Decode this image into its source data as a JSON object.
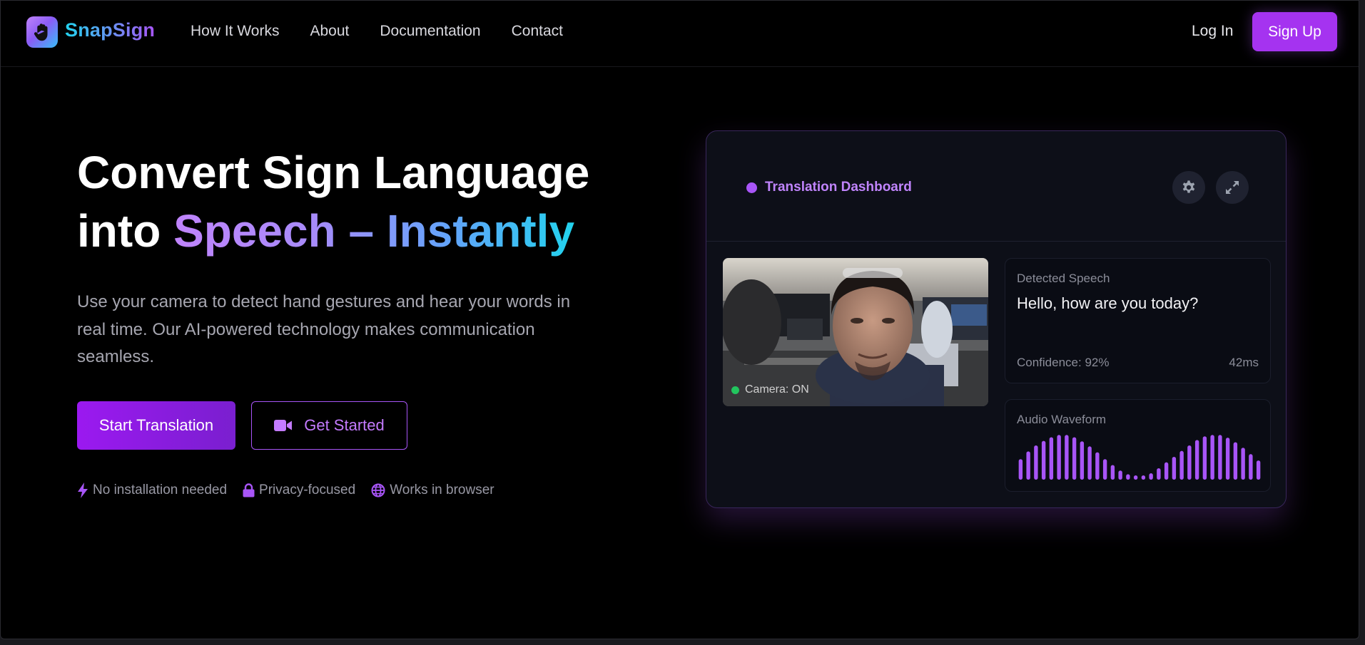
{
  "brand": {
    "name": "SnapSign",
    "logo_icon": "hand-icon"
  },
  "nav": {
    "links": [
      "How It Works",
      "About",
      "Documentation",
      "Contact"
    ],
    "login": "Log In",
    "signup": "Sign Up"
  },
  "hero": {
    "title_line1": "Convert Sign Language",
    "title_line2_plain": "into ",
    "title_line2_gradient": "Speech – Instantly",
    "description": "Use your camera to detect hand gestures and hear your words in real time. Our AI-powered technology makes communication seamless.",
    "primary_button": "Start Translation",
    "secondary_button": "Get Started",
    "secondary_icon": "video-camera-icon",
    "features": [
      {
        "icon": "bolt-icon",
        "label": "No installation needed"
      },
      {
        "icon": "lock-icon",
        "label": "Privacy-focused"
      },
      {
        "icon": "globe-icon",
        "label": "Works in browser"
      }
    ]
  },
  "dashboard": {
    "title": "Translation Dashboard",
    "settings_icon": "gear-icon",
    "fullscreen_icon": "expand-icon",
    "camera_status": "Camera: ON",
    "detected_label": "Detected Speech",
    "detected_text": "Hello, how are you today?",
    "confidence": "Confidence: 92%",
    "latency": "42ms",
    "waveform_label": "Audio Waveform",
    "waveform_levels": [
      0.45,
      0.62,
      0.75,
      0.85,
      0.93,
      0.98,
      0.98,
      0.93,
      0.84,
      0.73,
      0.6,
      0.45,
      0.32,
      0.2,
      0.12,
      0.08,
      0.08,
      0.14,
      0.25,
      0.38,
      0.5,
      0.63,
      0.75,
      0.87,
      0.95,
      0.98,
      0.98,
      0.92,
      0.82,
      0.7,
      0.56,
      0.42
    ]
  },
  "colors": {
    "accent": "#a855f7",
    "accent_dark": "#7a1fcf",
    "cyan": "#22d3ee",
    "camera_on": "#22c55e"
  }
}
